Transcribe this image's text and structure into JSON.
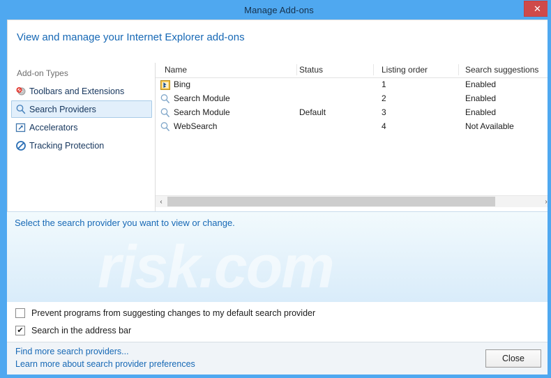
{
  "window": {
    "title": "Manage Add-ons",
    "close_icon": "close-icon",
    "close_glyph": "✕",
    "accent_color": "#4fa8f0",
    "close_button_color": "#cf4a4a"
  },
  "header": {
    "title": "View and manage your Internet Explorer add-ons",
    "link_color": "#1668b5"
  },
  "sidebar": {
    "title": "Add-on Types",
    "items": [
      {
        "label": "Toolbars and Extensions",
        "icon": "toolbars-extensions-icon",
        "selected": false
      },
      {
        "label": "Search Providers",
        "icon": "magnifier-icon",
        "selected": true
      },
      {
        "label": "Accelerators",
        "icon": "accelerator-arrow-icon",
        "selected": false
      },
      {
        "label": "Tracking Protection",
        "icon": "block-circle-icon",
        "selected": false
      }
    ]
  },
  "table": {
    "columns": [
      {
        "key": "name",
        "label": "Name"
      },
      {
        "key": "status",
        "label": "Status"
      },
      {
        "key": "order",
        "label": "Listing order",
        "sorted": "ascending"
      },
      {
        "key": "suggestions",
        "label": "Search suggestions"
      }
    ],
    "rows": [
      {
        "icon": "bing-icon",
        "name": "Bing",
        "status": "",
        "order": "1",
        "suggestions": "Enabled"
      },
      {
        "icon": "magnifier-icon",
        "name": "Search Module",
        "status": "",
        "order": "2",
        "suggestions": "Enabled"
      },
      {
        "icon": "magnifier-icon",
        "name": "Search Module",
        "status": "Default",
        "order": "3",
        "suggestions": "Enabled"
      },
      {
        "icon": "magnifier-icon",
        "name": "WebSearch",
        "status": "",
        "order": "4",
        "suggestions": "Not Available"
      }
    ]
  },
  "scrollbar": {
    "left_glyph": "‹",
    "right_glyph": "›"
  },
  "info": {
    "text": "Select the search provider you want to view or change.",
    "watermark": "risk.com"
  },
  "options": [
    {
      "label": "Prevent programs from suggesting changes to my default search provider",
      "checked": false
    },
    {
      "label": "Search in the address bar",
      "checked": true
    }
  ],
  "check_glyph": "✔",
  "footer": {
    "links": [
      "Find more search providers...",
      "Learn more about search provider preferences"
    ],
    "close_label": "Close"
  }
}
